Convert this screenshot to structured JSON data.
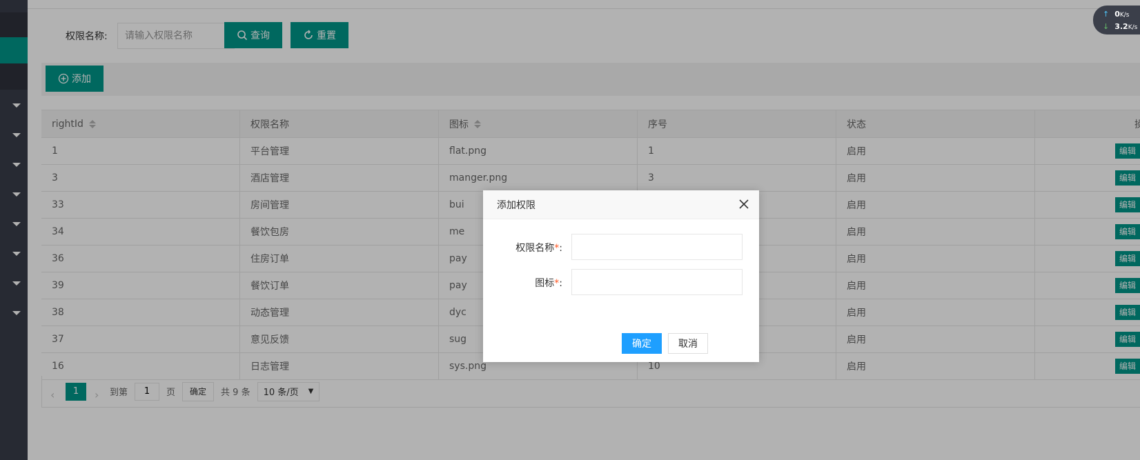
{
  "search": {
    "label": "权限名称:",
    "placeholder": "请输入权限名称",
    "value": ""
  },
  "buttons": {
    "query": "查询",
    "reset": "重置",
    "add": "添加"
  },
  "table": {
    "headers": [
      "rightId",
      "权限名称",
      "图标",
      "序号",
      "状态",
      "操"
    ],
    "rows": [
      {
        "id": "1",
        "name": "平台管理",
        "icon": "flat.png",
        "order": "1",
        "status": "启用",
        "action": "编辑"
      },
      {
        "id": "3",
        "name": "酒店管理",
        "icon": "manger.png",
        "order": "3",
        "status": "启用",
        "action": "编辑"
      },
      {
        "id": "33",
        "name": "房间管理",
        "icon": "bui",
        "order": "",
        "status": "启用",
        "action": "编辑"
      },
      {
        "id": "34",
        "name": "餐饮包房",
        "icon": "me",
        "order": "",
        "status": "启用",
        "action": "编辑"
      },
      {
        "id": "36",
        "name": "住房订单",
        "icon": "pay",
        "order": "",
        "status": "启用",
        "action": "编辑"
      },
      {
        "id": "39",
        "name": "餐饮订单",
        "icon": "pay",
        "order": "",
        "status": "启用",
        "action": "编辑"
      },
      {
        "id": "38",
        "name": "动态管理",
        "icon": "dyc",
        "order": "",
        "status": "启用",
        "action": "编辑"
      },
      {
        "id": "37",
        "name": "意见反馈",
        "icon": "sug",
        "order": "",
        "status": "启用",
        "action": "编辑"
      },
      {
        "id": "16",
        "name": "日志管理",
        "icon": "sys.png",
        "order": "10",
        "status": "启用",
        "action": "编辑"
      }
    ]
  },
  "pagination": {
    "current": "1",
    "goto_label": "到第",
    "goto_value": "1",
    "page_label": "页",
    "confirm": "确定",
    "total": "共 9 条",
    "page_size": "10 条/页"
  },
  "network": {
    "up": "0",
    "up_unit": "K/s",
    "down": "3.2",
    "down_unit": "K/s"
  },
  "dialog": {
    "title": "添加权限",
    "fields": [
      {
        "label": "权限名称",
        "required": "*",
        "suffix": ":",
        "value": ""
      },
      {
        "label": "图标",
        "required": "*",
        "suffix": ":",
        "value": ""
      }
    ],
    "confirm": "确定",
    "cancel": "取消"
  },
  "colors": {
    "primary": "#009688",
    "sidebar": "#393d49",
    "dialog_confirm": "#1e9fff",
    "required": "#ff5722"
  }
}
